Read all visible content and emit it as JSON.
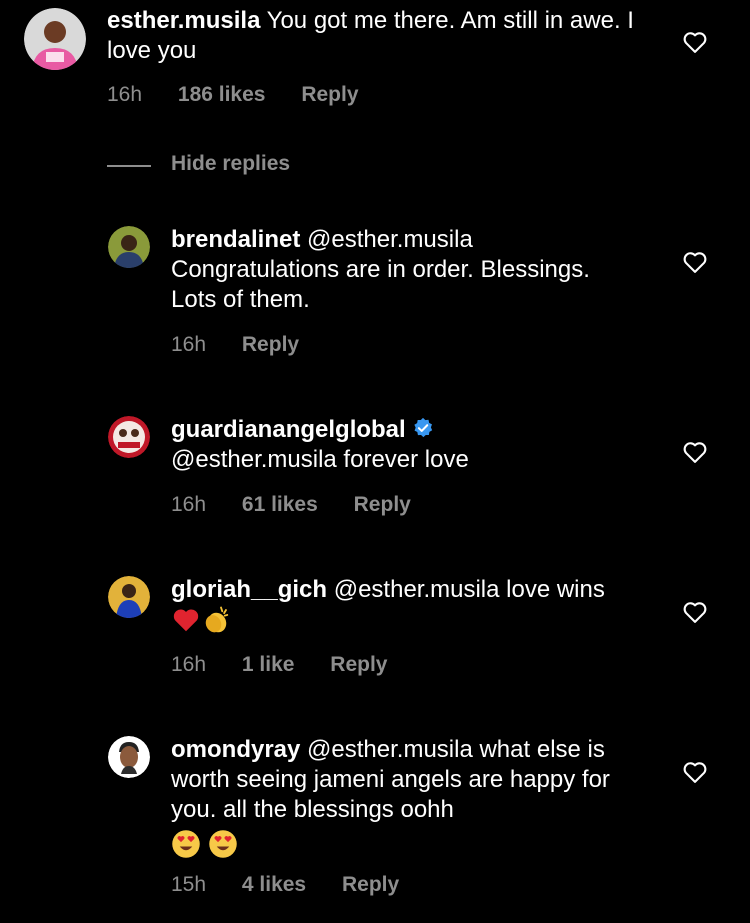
{
  "comments": [
    {
      "username": "esther.musila",
      "text": "You got me there.  Am still in awe. I love you",
      "time": "16h",
      "likes": "186 likes",
      "reply": "Reply"
    },
    {
      "username": "brendalinet",
      "text": "@esther.musila Congratulations are in order. Blessings. Lots of them.",
      "time": "16h",
      "likes": "",
      "reply": "Reply"
    },
    {
      "username": "guardianangelglobal",
      "text": "@esther.musila forever love",
      "time": "16h",
      "likes": "61 likes",
      "reply": "Reply"
    },
    {
      "username": "gloriah__gich",
      "text": "@esther.musila love wins",
      "time": "16h",
      "likes": "1 like",
      "reply": "Reply"
    },
    {
      "username": "omondyray",
      "text": "@esther.musila what else is worth seeing jameni angels are happy for you. all the blessings oohh",
      "time": "15h",
      "likes": "4 likes",
      "reply": "Reply"
    }
  ],
  "hide_replies_label": "Hide replies",
  "icons": {
    "like": "heart-outline-icon",
    "verified": "verified-badge-icon",
    "emoji_heart": "red-heart-emoji",
    "emoji_clap": "clapping-hands-emoji",
    "emoji_love_eyes": "heart-eyes-emoji"
  },
  "colors": {
    "background": "#000000",
    "text": "#ffffff",
    "muted": "#8e8e8e",
    "verified": "#3897f0"
  }
}
